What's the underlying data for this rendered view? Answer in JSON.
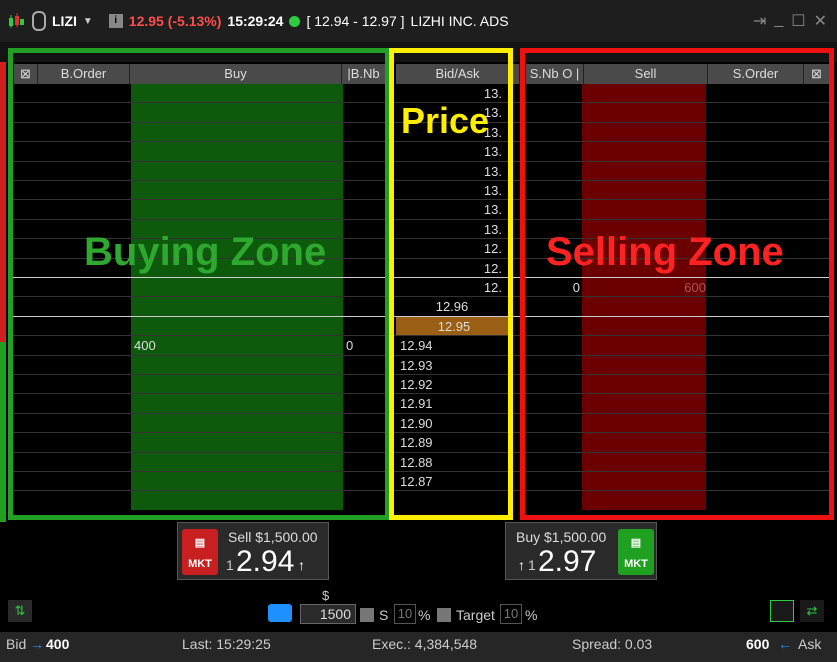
{
  "title": {
    "symbol": "LIZI",
    "price_change": "12.95 (-5.13%)",
    "time": "15:29:24",
    "range": "[ 12.94 - 12.97 ]",
    "company": "LIZHI INC. ADS"
  },
  "columns": {
    "b_order": "B.Order",
    "buy": "Buy",
    "b_nb": "|B.Nb",
    "bid_ask": "Bid/Ask",
    "s_nb": "S.Nb O |",
    "sell": "Sell",
    "s_order": "S.Order"
  },
  "ladder": {
    "ask_prices": [
      "13.",
      "13.",
      "13.",
      "13.",
      "13.",
      "13.",
      "13.",
      "13.",
      "12.",
      "12.",
      "12."
    ],
    "prices_mid": [
      "12.96",
      "12.95"
    ],
    "bid_prices": [
      "12.94",
      "12.93",
      "12.92",
      "12.91",
      "12.90",
      "12.89",
      "12.88",
      "12.87"
    ],
    "buy_size": "400",
    "buy_nb": "0",
    "sell_nb": "0",
    "sell_size": "600"
  },
  "zones": {
    "buying": "Buying Zone",
    "selling": "Selling Zone",
    "price": "Price"
  },
  "sell_panel": {
    "label": "Sell $1,500.00",
    "prefix": "1",
    "price": "2.94",
    "mkt": "MKT"
  },
  "buy_panel": {
    "label": "Buy $1,500.00",
    "prefix": "1",
    "price": "2.97",
    "mkt": "MKT"
  },
  "controls": {
    "currency": "$",
    "quantity": "1500",
    "s_label": "S",
    "s_value": "10",
    "pct": "%",
    "target_label": "Target",
    "target_value": "10",
    "pct2": "%"
  },
  "status": {
    "bid": "Bid",
    "bid_size": "400",
    "last": "Last: 15:29:25",
    "exec": "Exec.: 4,384,548",
    "spread": "Spread: 0.03",
    "ask_size": "600",
    "ask": "Ask"
  },
  "colors": {
    "buy": "#0d5a0d",
    "sell": "#6a0000",
    "price_down": "#ff4d4d"
  }
}
